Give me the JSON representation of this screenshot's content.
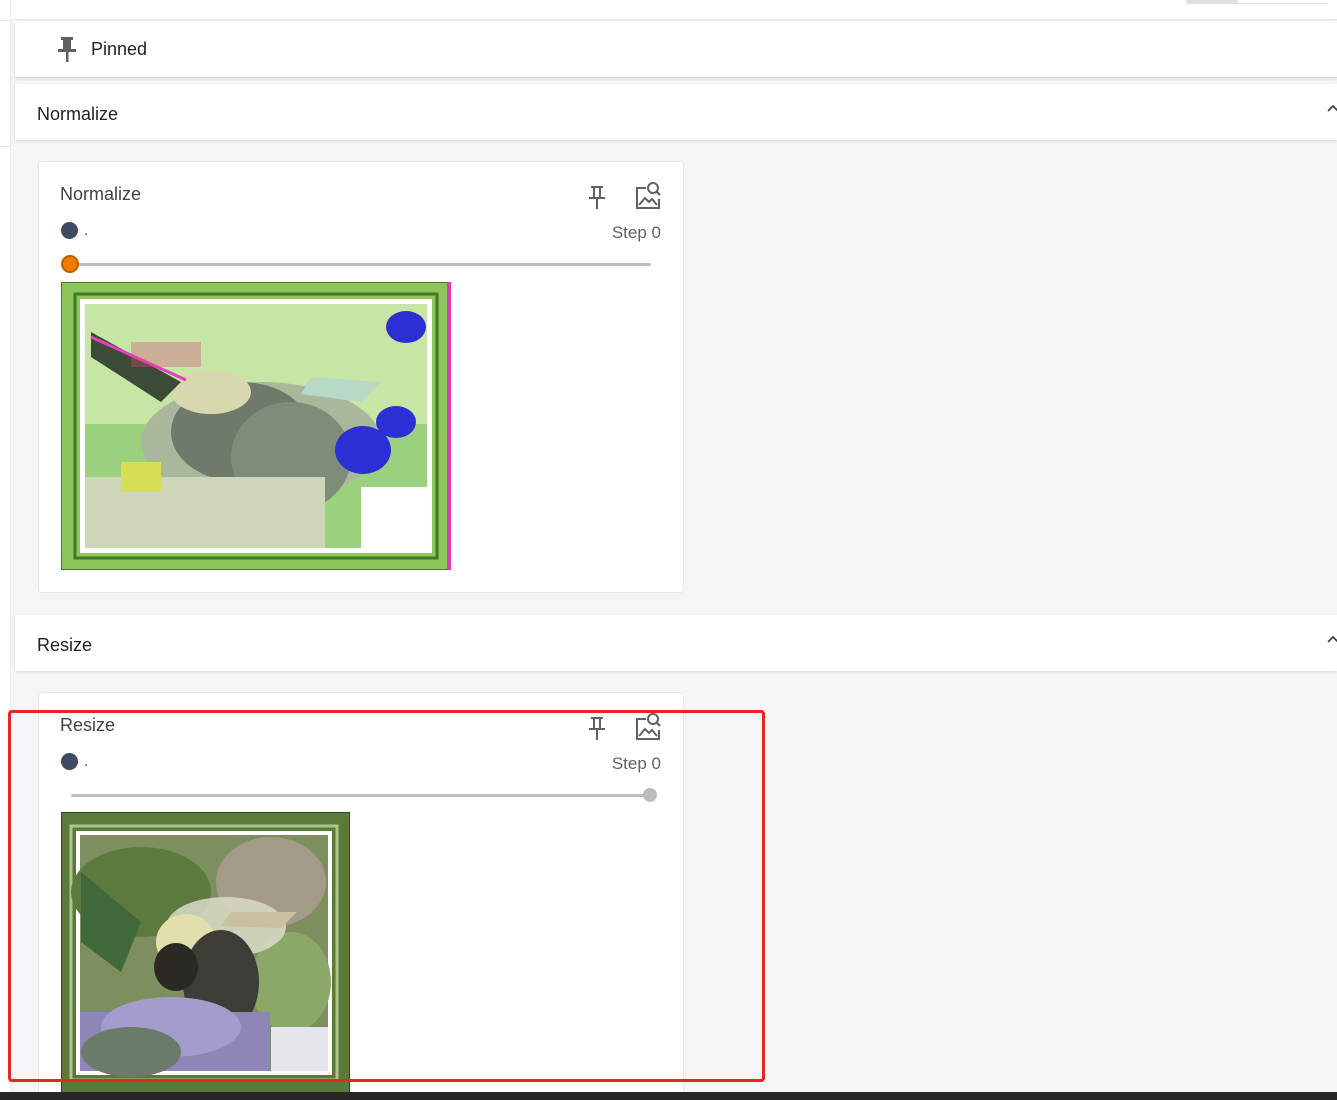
{
  "pinned": {
    "label": "Pinned",
    "icon": "pin-icon"
  },
  "sections": [
    {
      "header": "Normalize",
      "card": {
        "title": "Normalize",
        "run_name": ".",
        "step": "Step 0",
        "slider_value": 0,
        "icons": [
          "pin-icon",
          "image-search-icon"
        ],
        "image": "bee-normalized-image"
      }
    },
    {
      "header": "Resize",
      "card": {
        "title": "Resize",
        "run_name": ".",
        "step": "Step 0",
        "slider_value": 1,
        "icons": [
          "pin-icon",
          "image-search-icon"
        ],
        "image": "bee-resized-image"
      }
    }
  ],
  "colors": {
    "run_dot": "#3e4b63",
    "slider_active": "#ef7c00",
    "highlight_box": "#e8261f"
  }
}
